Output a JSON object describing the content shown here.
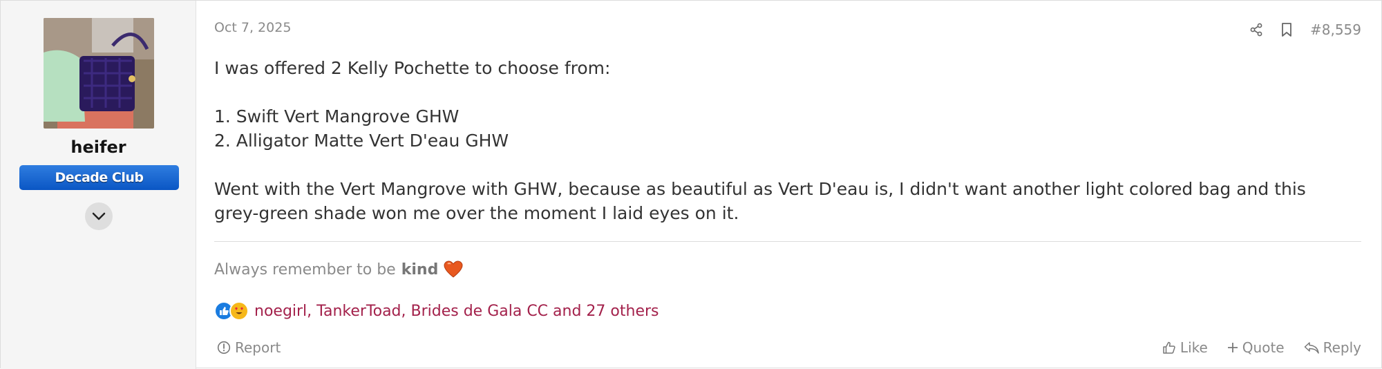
{
  "user": {
    "username": "heifer",
    "badge": "Decade Club"
  },
  "post": {
    "date": "Oct 7, 2025",
    "number": "#8,559",
    "body": {
      "line1": "I was offered 2 Kelly Pochette to choose from:",
      "item1": "1. Swift Vert Mangrove GHW",
      "item2": "2. Alligator Matte Vert D'eau GHW",
      "para2_line1": "Went with the Vert Mangrove with GHW, because as beautiful as Vert D'eau is, I didn't want another light colored bag and this",
      "para2_line2": "grey-green shade won me over the moment I laid eyes on it."
    },
    "signature": {
      "text": "Always remember to be",
      "bold": "kind"
    },
    "reactions": {
      "text": "noegirl, TankerToad, Brides de Gala CC and 27 others"
    }
  },
  "actions": {
    "report": "Report",
    "like": "Like",
    "quote": "Quote",
    "reply": "Reply"
  },
  "colors": {
    "badge": "#0a56c4",
    "reaction_link": "#a3214b",
    "muted": "#8a8a8a"
  }
}
